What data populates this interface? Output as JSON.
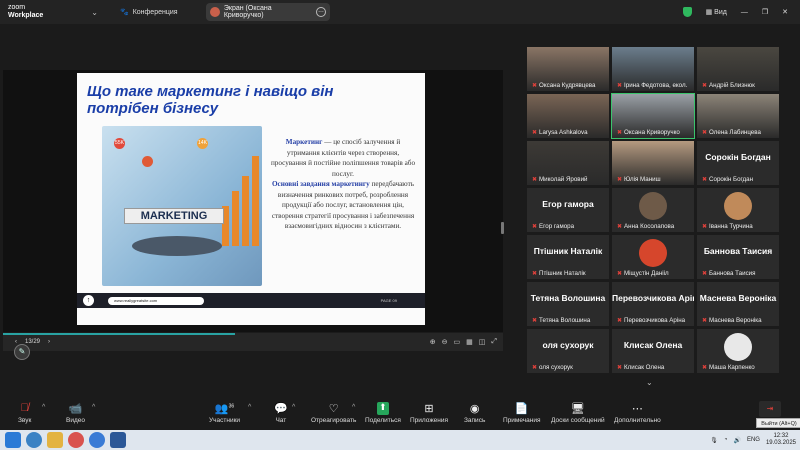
{
  "titlebar": {
    "app_line1": "zoom",
    "app_line2": "Workplace",
    "meeting": "Конференция",
    "screen_label": "Экран (Оксана Криворучко)",
    "view_label": "Вид"
  },
  "slide": {
    "title": "Що таке маркетинг і навіщо він потрібен бізнесу",
    "image_word": "MARKETING",
    "k1": "Маркетинг",
    "p1": " — це спосіб залучення й утримання клієнтів через створення, просування й постійне поліпшення товарів або послуг.",
    "k2": "Основні завдання маркетингу",
    "p2": " передбачають визначення ринкових потреб, розроблення продукції або послуг, встановлення цін, створення стратегії просування і забезпечення взаємовигідних відносин з клієнтами.",
    "url": "www.reallygreatsite.com",
    "page": "PAGE 09"
  },
  "sharebar": {
    "page_counter": "13/29",
    "prev": "‹",
    "next": "›"
  },
  "participants": [
    {
      "name": "Оксана Кудрявцева",
      "kind": "video",
      "color": "#8a7565"
    },
    {
      "name": "Ірина Федотова, екол.",
      "kind": "video",
      "color": "#6b7d8c"
    },
    {
      "name": "Андрій Близнюк",
      "kind": "video",
      "color": "#4a4740"
    },
    {
      "name": "Larysa Ashkalova",
      "kind": "video",
      "color": "#7a6555"
    },
    {
      "name": "Оксана Криворучко",
      "kind": "video",
      "color": "#9aa0a6",
      "active": true
    },
    {
      "name": "Олена Лабинцева",
      "kind": "video",
      "color": "#8c8478"
    },
    {
      "name": "Миколай Яровий",
      "kind": "video",
      "color": "#3d3a36"
    },
    {
      "name": "Юлія Маниш",
      "kind": "video",
      "color": "#b59a80"
    },
    {
      "name": "Сорокін Богдан",
      "kind": "text",
      "big": "Сорокін Богдан"
    },
    {
      "name": "Егор гамора",
      "kind": "text",
      "big": "Егор гамора"
    },
    {
      "name": "Анна Косолапова",
      "kind": "avatar",
      "color": "#6e5a48"
    },
    {
      "name": "Іванна Турчина",
      "kind": "avatar",
      "color": "#c08a5a"
    },
    {
      "name": "Птішник Наталік",
      "kind": "text",
      "big": "Птішник Наталік"
    },
    {
      "name": "Міщустін Данііл",
      "kind": "avatar",
      "color": "#d6462c"
    },
    {
      "name": "Баннова Таисия",
      "kind": "text",
      "big": "Баннова Таисия"
    },
    {
      "name": "Тетяна Волошина",
      "kind": "text",
      "big": "Тетяна Волошина"
    },
    {
      "name": "Перевозчикова Аріна",
      "kind": "text",
      "big": "Перевозчикова Аріна"
    },
    {
      "name": "Маснева Вероніка",
      "kind": "text",
      "big": "Маснева Вероніка"
    },
    {
      "name": "оля сухорук",
      "kind": "text",
      "big": "оля сухорук"
    },
    {
      "name": "Клисак Олена",
      "kind": "text",
      "big": "Клисак Олена"
    },
    {
      "name": "Маша Карпенко",
      "kind": "avatar",
      "color": "#e8e8e8"
    }
  ],
  "toolbar": {
    "audio": "Звук",
    "video": "Видео",
    "participants": "Участники",
    "participants_count": "36",
    "chat": "Чат",
    "react": "Отреагировать",
    "share": "Поделиться",
    "apps": "Приложения",
    "record": "Запись",
    "notes": "Примечания",
    "boards": "Доски сообщений",
    "more": "Дополнительно",
    "leave_tooltip": "Выйти (Alt+Q)"
  },
  "taskbar": {
    "lang": "ENG",
    "time": "12:32",
    "date": "19.03.2025"
  }
}
